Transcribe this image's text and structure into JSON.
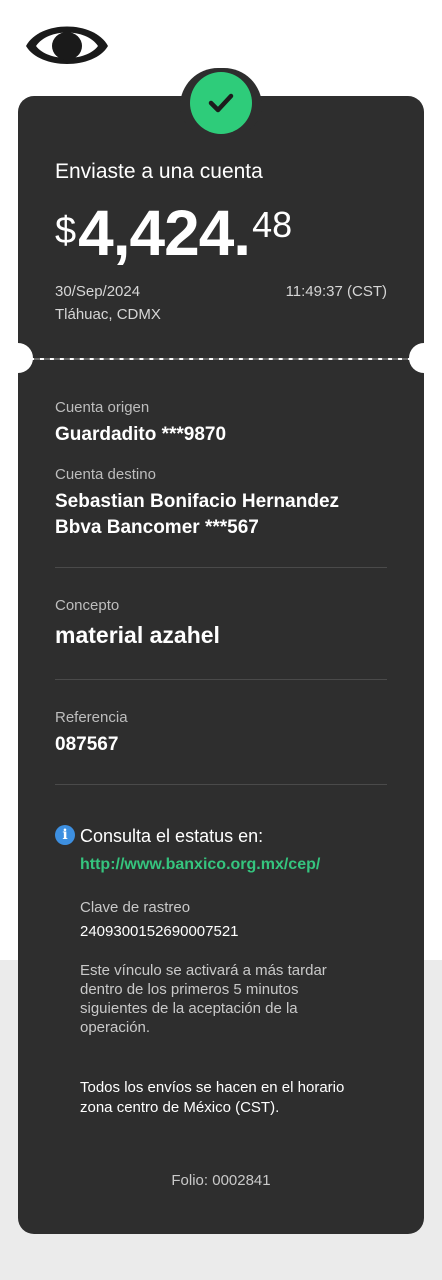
{
  "header": {
    "logo_icon": "eye-logo-icon",
    "status_icon": "check-icon",
    "status_color": "#2ecc7a"
  },
  "summary": {
    "title": "Enviaste a una cuenta",
    "amount_currency": "$",
    "amount_integer": "4,424.",
    "amount_cents": "48",
    "date": "30/Sep/2024",
    "time": "11:49:37 (CST)",
    "location": "Tláhuac, CDMX"
  },
  "details": {
    "origin_label": "Cuenta origen",
    "origin_value": "Guardadito ***9870",
    "destination_label": "Cuenta destino",
    "destination_name": "Sebastian Bonifacio Hernandez",
    "destination_bank": "Bbva Bancomer ***567",
    "concept_label": "Concepto",
    "concept_value": "material azahel",
    "reference_label": "Referencia",
    "reference_value": "087567"
  },
  "status": {
    "info_icon": "info-icon",
    "consult_text": "Consulta el estatus en:",
    "link": "http://www.banxico.org.mx/cep/",
    "tracking_label": "Clave de rastreo",
    "tracking_value": "2409300152690007521",
    "activation_note_1": "Este vínculo se activará a más tardar",
    "activation_note_2": "dentro de los primeros 5 minutos",
    "activation_note_3": "siguientes de la aceptación de la",
    "activation_note_4": "operación.",
    "schedule_note_1": "Todos los envíos se hacen en el horario",
    "schedule_note_2": "zona centro de México (CST).",
    "folio": "Folio: 0002841"
  }
}
